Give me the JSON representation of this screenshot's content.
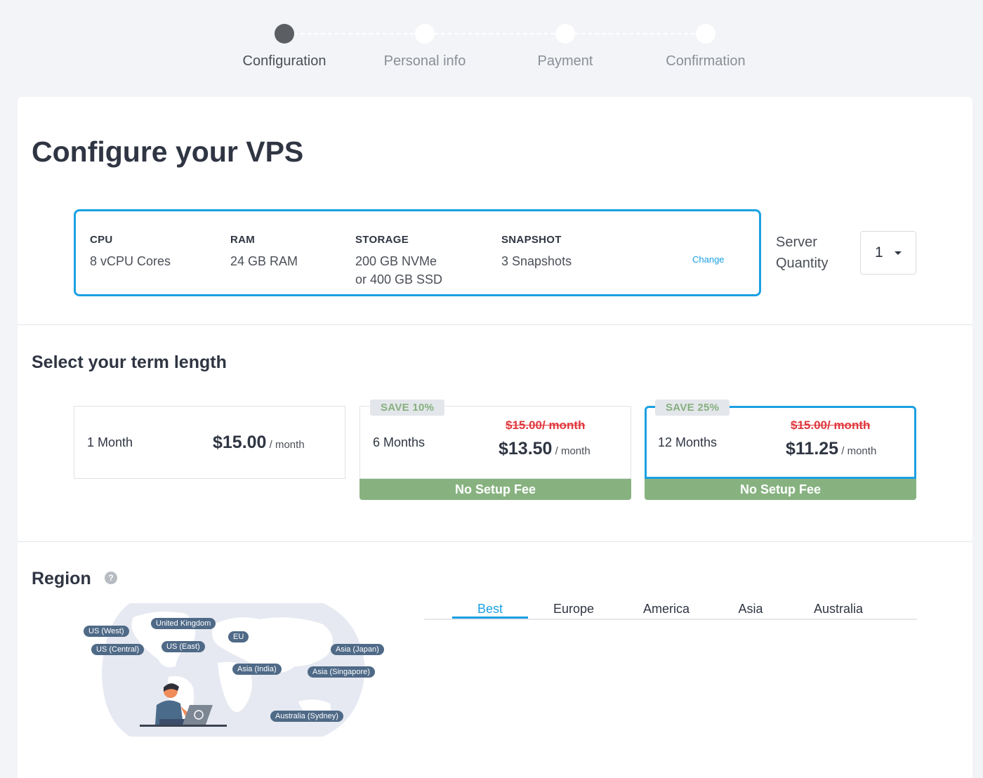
{
  "stepper": {
    "steps": [
      {
        "label": "Configuration",
        "active": true
      },
      {
        "label": "Personal info",
        "active": false
      },
      {
        "label": "Payment",
        "active": false
      },
      {
        "label": "Confirmation",
        "active": false
      }
    ]
  },
  "page": {
    "title": "Configure your VPS"
  },
  "specs": {
    "cpu": {
      "heading": "CPU",
      "value": "8 vCPU Cores"
    },
    "ram": {
      "heading": "RAM",
      "value": "24 GB RAM"
    },
    "storage": {
      "heading": "STORAGE",
      "value_line1": "200 GB NVMe",
      "value_line2": "or 400 GB SSD"
    },
    "snapshot": {
      "heading": "SNAPSHOT",
      "value": "3 Snapshots"
    },
    "change_label": "Change"
  },
  "quantity": {
    "label_line1": "Server",
    "label_line2": "Quantity",
    "value": "1"
  },
  "term": {
    "title": "Select your term length",
    "options": [
      {
        "name": "1 Month",
        "price": "$15.00",
        "unit": " / month",
        "old_price": "",
        "save": "",
        "fee": "",
        "selected": false
      },
      {
        "name": "6 Months",
        "price": "$13.50",
        "unit": " / month",
        "old_price": "$15.00/ month",
        "save": "SAVE 10%",
        "fee": "No Setup Fee",
        "selected": false
      },
      {
        "name": "12 Months",
        "price": "$11.25",
        "unit": " / month",
        "old_price": "$15.00/ month",
        "save": "SAVE 25%",
        "fee": "No Setup Fee",
        "selected": true
      }
    ]
  },
  "region": {
    "title": "Region",
    "help_icon": "question-circle-icon",
    "map_locations": [
      "US (West)",
      "United Kingdom",
      "US (Central)",
      "US (East)",
      "EU",
      "Asia (Japan)",
      "Asia (India)",
      "Asia (Singapore)",
      "Australia (Sydney)"
    ],
    "tabs": [
      {
        "label": "Best",
        "active": true
      },
      {
        "label": "Europe",
        "active": false
      },
      {
        "label": "America",
        "active": false
      },
      {
        "label": "Asia",
        "active": false
      },
      {
        "label": "Australia",
        "active": false
      }
    ]
  },
  "colors": {
    "accent": "#1ba0e2",
    "save_green": "#87b280",
    "strike_red": "#e0383e"
  }
}
